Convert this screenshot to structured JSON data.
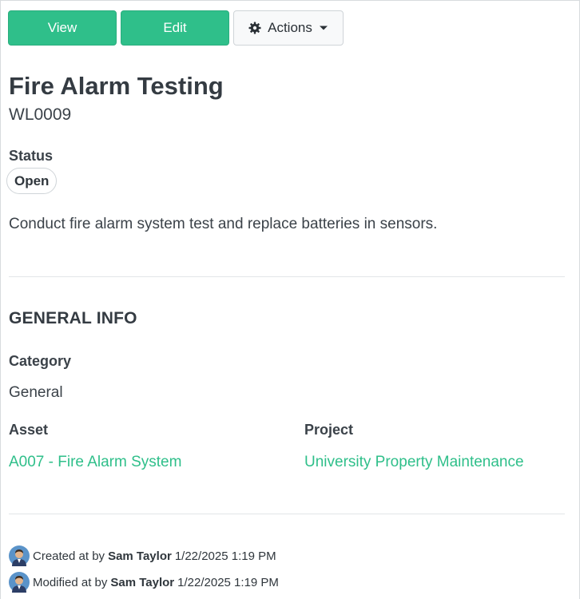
{
  "toolbar": {
    "view_label": "View",
    "edit_label": "Edit",
    "actions_label": "Actions"
  },
  "record": {
    "title": "Fire Alarm Testing",
    "code": "WL0009",
    "status_label": "Status",
    "status_value": "Open",
    "description": "Conduct fire alarm system test and replace batteries in sensors."
  },
  "general_info": {
    "heading": "GENERAL INFO",
    "category_label": "Category",
    "category_value": "General",
    "asset_label": "Asset",
    "asset_value": "A007 - Fire Alarm System",
    "project_label": "Project",
    "project_value": "University Property Maintenance"
  },
  "audit": {
    "created_prefix": "Created at by",
    "created_user": "Sam Taylor",
    "created_time": "1/22/2025 1:19 PM",
    "modified_prefix": "Modified at by",
    "modified_user": "Sam Taylor",
    "modified_time": "1/22/2025 1:19 PM"
  },
  "colors": {
    "accent": "#2fbf8a",
    "text": "#3b4249",
    "divider": "#e2e5e8"
  },
  "icons": {
    "actions_icon": "gear-icon",
    "dropdown_icon": "caret-down-icon",
    "avatar_icon": "user-avatar"
  }
}
